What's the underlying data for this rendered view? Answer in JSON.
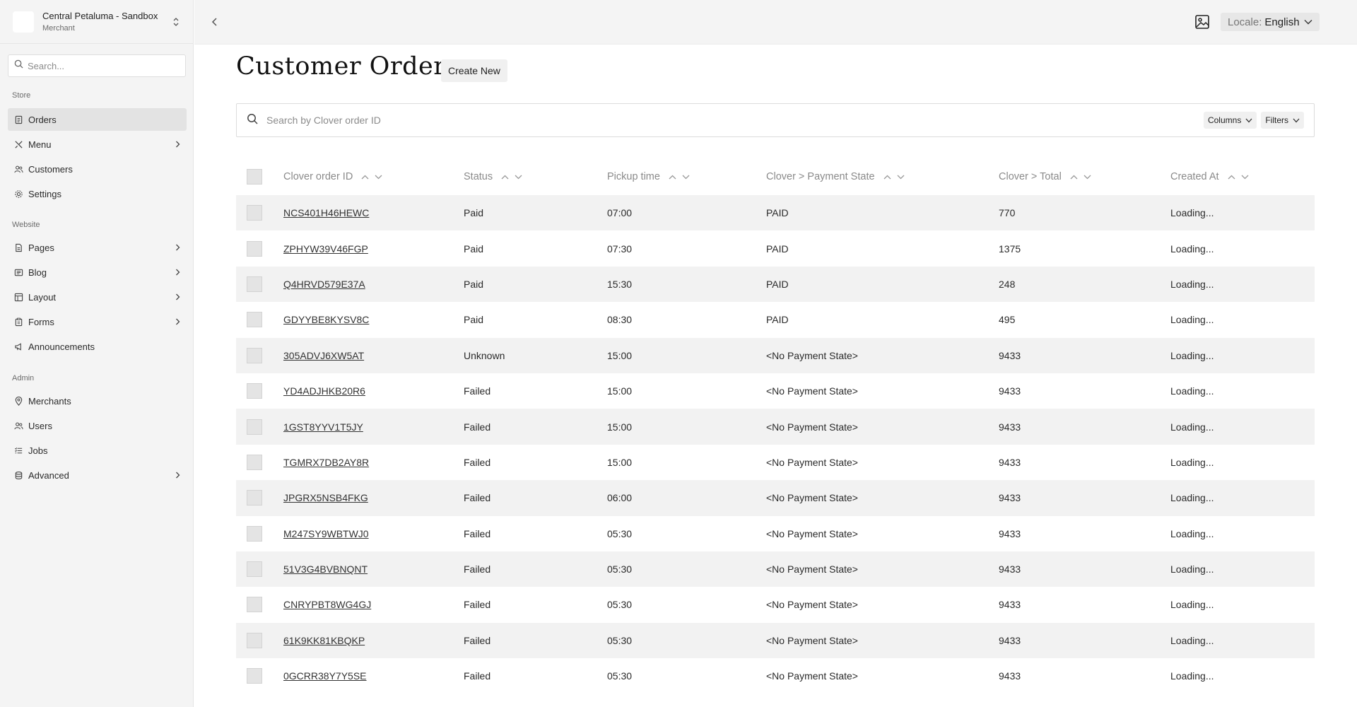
{
  "merchant": {
    "name": "Central Petaluma - Sandbox",
    "role": "Merchant"
  },
  "sidebar": {
    "search_placeholder": "Search...",
    "sections": {
      "store": "Store",
      "website": "Website",
      "admin": "Admin"
    },
    "items": [
      {
        "label": "Orders",
        "icon": "receipt-icon",
        "active": true,
        "chevron": false
      },
      {
        "label": "Menu",
        "icon": "utensils-icon",
        "active": false,
        "chevron": true
      },
      {
        "label": "Customers",
        "icon": "users-icon",
        "active": false,
        "chevron": false
      },
      {
        "label": "Settings",
        "icon": "gear-icon",
        "active": false,
        "chevron": false
      },
      {
        "label": "Pages",
        "icon": "document-icon",
        "active": false,
        "chevron": true
      },
      {
        "label": "Blog",
        "icon": "newspaper-icon",
        "active": false,
        "chevron": true
      },
      {
        "label": "Layout",
        "icon": "layout-icon",
        "active": false,
        "chevron": true
      },
      {
        "label": "Forms",
        "icon": "clipboard-icon",
        "active": false,
        "chevron": true
      },
      {
        "label": "Announcements",
        "icon": "megaphone-icon",
        "active": false,
        "chevron": false
      },
      {
        "label": "Merchants",
        "icon": "map-pin-icon",
        "active": false,
        "chevron": false
      },
      {
        "label": "Users",
        "icon": "users-icon",
        "active": false,
        "chevron": false
      },
      {
        "label": "Jobs",
        "icon": "list-icon",
        "active": false,
        "chevron": false
      },
      {
        "label": "Advanced",
        "icon": "database-icon",
        "active": false,
        "chevron": true
      }
    ]
  },
  "topbar": {
    "locale_key": "Locale:",
    "locale_value": "English"
  },
  "page": {
    "title": "Customer Orders",
    "create_label": "Create New",
    "search_placeholder": "Search by Clover order ID",
    "columns_label": "Columns",
    "filters_label": "Filters"
  },
  "table": {
    "headers": [
      "Clover order ID",
      "Status",
      "Pickup time",
      "Clover > Payment State",
      "Clover > Total",
      "Created At"
    ],
    "rows": [
      [
        "NCS401H46HEWC",
        "Paid",
        "07:00",
        "PAID",
        "770",
        "Loading..."
      ],
      [
        "ZPHYW39V46FGP",
        "Paid",
        "07:30",
        "PAID",
        "1375",
        "Loading..."
      ],
      [
        "Q4HRVD579E37A",
        "Paid",
        "15:30",
        "PAID",
        "248",
        "Loading..."
      ],
      [
        "GDYYBE8KYSV8C",
        "Paid",
        "08:30",
        "PAID",
        "495",
        "Loading..."
      ],
      [
        "305ADVJ6XW5AT",
        "Unknown",
        "15:00",
        "<No Payment State>",
        "9433",
        "Loading..."
      ],
      [
        "YD4ADJHKB20R6",
        "Failed",
        "15:00",
        "<No Payment State>",
        "9433",
        "Loading..."
      ],
      [
        "1GST8YYV1T5JY",
        "Failed",
        "15:00",
        "<No Payment State>",
        "9433",
        "Loading..."
      ],
      [
        "TGMRX7DB2AY8R",
        "Failed",
        "15:00",
        "<No Payment State>",
        "9433",
        "Loading..."
      ],
      [
        "JPGRX5NSB4FKG",
        "Failed",
        "06:00",
        "<No Payment State>",
        "9433",
        "Loading..."
      ],
      [
        "M247SY9WBTWJ0",
        "Failed",
        "05:30",
        "<No Payment State>",
        "9433",
        "Loading..."
      ],
      [
        "51V3G4BVBNQNT",
        "Failed",
        "05:30",
        "<No Payment State>",
        "9433",
        "Loading..."
      ],
      [
        "CNRYPBT8WG4GJ",
        "Failed",
        "05:30",
        "<No Payment State>",
        "9433",
        "Loading..."
      ],
      [
        "61K9KK81KBQKP",
        "Failed",
        "05:30",
        "<No Payment State>",
        "9433",
        "Loading..."
      ],
      [
        "0GCRR38Y7Y5SE",
        "Failed",
        "05:30",
        "<No Payment State>",
        "9433",
        "Loading..."
      ]
    ]
  }
}
